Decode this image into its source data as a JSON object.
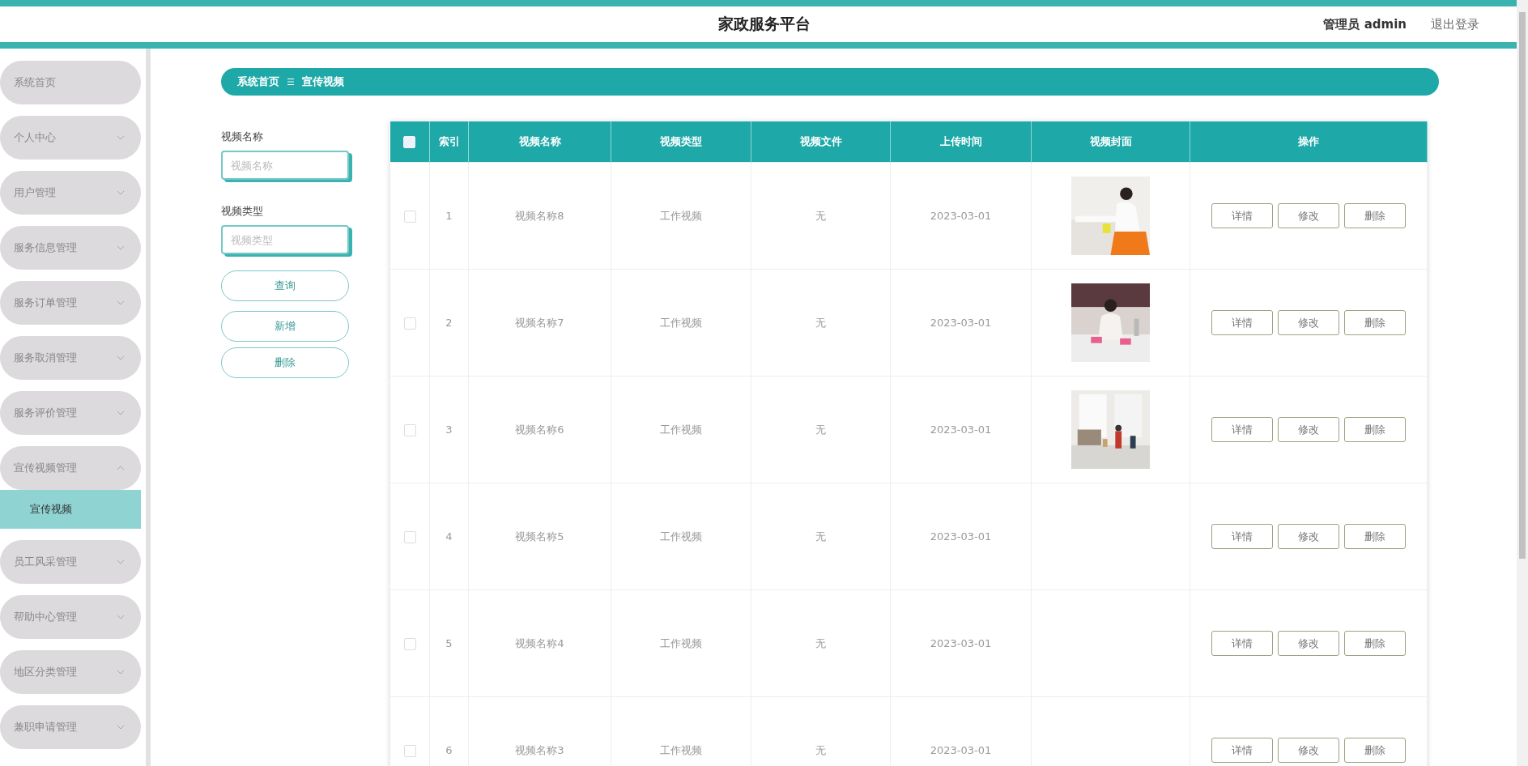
{
  "header": {
    "title": "家政服务平台",
    "user": "管理员 admin",
    "logout": "退出登录"
  },
  "sidebar": {
    "items": [
      {
        "label": "系统首页",
        "kind": "link"
      },
      {
        "label": "个人中心",
        "kind": "menu",
        "expanded": false
      },
      {
        "label": "用户管理",
        "kind": "menu",
        "expanded": false
      },
      {
        "label": "服务信息管理",
        "kind": "menu",
        "expanded": false
      },
      {
        "label": "服务订单管理",
        "kind": "menu",
        "expanded": false
      },
      {
        "label": "服务取消管理",
        "kind": "menu",
        "expanded": false
      },
      {
        "label": "服务评价管理",
        "kind": "menu",
        "expanded": false
      },
      {
        "label": "宣传视频管理",
        "kind": "menu",
        "expanded": true,
        "children": [
          {
            "label": "宣传视频",
            "selected": true
          }
        ]
      },
      {
        "label": "员工风采管理",
        "kind": "menu",
        "expanded": false
      },
      {
        "label": "帮助中心管理",
        "kind": "menu",
        "expanded": false
      },
      {
        "label": "地区分类管理",
        "kind": "menu",
        "expanded": false
      },
      {
        "label": "兼职申请管理",
        "kind": "menu",
        "expanded": false
      }
    ]
  },
  "breadcrumb": [
    "系统首页",
    "宣传视频"
  ],
  "search": {
    "fields": [
      {
        "label": "视频名称",
        "placeholder": "视频名称"
      },
      {
        "label": "视频类型",
        "placeholder": "视频类型"
      }
    ],
    "buttons": [
      "查询",
      "新增",
      "删除"
    ]
  },
  "table": {
    "select_all_checked": false,
    "columns": [
      "索引",
      "视频名称",
      "视频类型",
      "视频文件",
      "上传时间",
      "视频封面",
      "操作"
    ],
    "rows": [
      {
        "checked": false,
        "index": "1",
        "name": "视频名称8",
        "type": "工作视频",
        "file": "无",
        "time": "2023-03-01",
        "cover": true,
        "actions": [
          "详情",
          "修改",
          "删除"
        ]
      },
      {
        "checked": false,
        "index": "2",
        "name": "视频名称7",
        "type": "工作视频",
        "file": "无",
        "time": "2023-03-01",
        "cover": true,
        "actions": [
          "详情",
          "修改",
          "删除"
        ]
      },
      {
        "checked": false,
        "index": "3",
        "name": "视频名称6",
        "type": "工作视频",
        "file": "无",
        "time": "2023-03-01",
        "cover": true,
        "actions": [
          "详情",
          "修改",
          "删除"
        ]
      },
      {
        "checked": false,
        "index": "4",
        "name": "视频名称5",
        "type": "工作视频",
        "file": "无",
        "time": "2023-03-01",
        "cover": false,
        "actions": [
          "详情",
          "修改",
          "删除"
        ]
      },
      {
        "checked": false,
        "index": "5",
        "name": "视频名称4",
        "type": "工作视频",
        "file": "无",
        "time": "2023-03-01",
        "cover": false,
        "actions": [
          "详情",
          "修改",
          "删除"
        ]
      },
      {
        "checked": false,
        "index": "6",
        "name": "视频名称3",
        "type": "工作视频",
        "file": "无",
        "time": "2023-03-01",
        "cover": false,
        "actions": [
          "详情",
          "修改",
          "删除"
        ]
      }
    ]
  }
}
